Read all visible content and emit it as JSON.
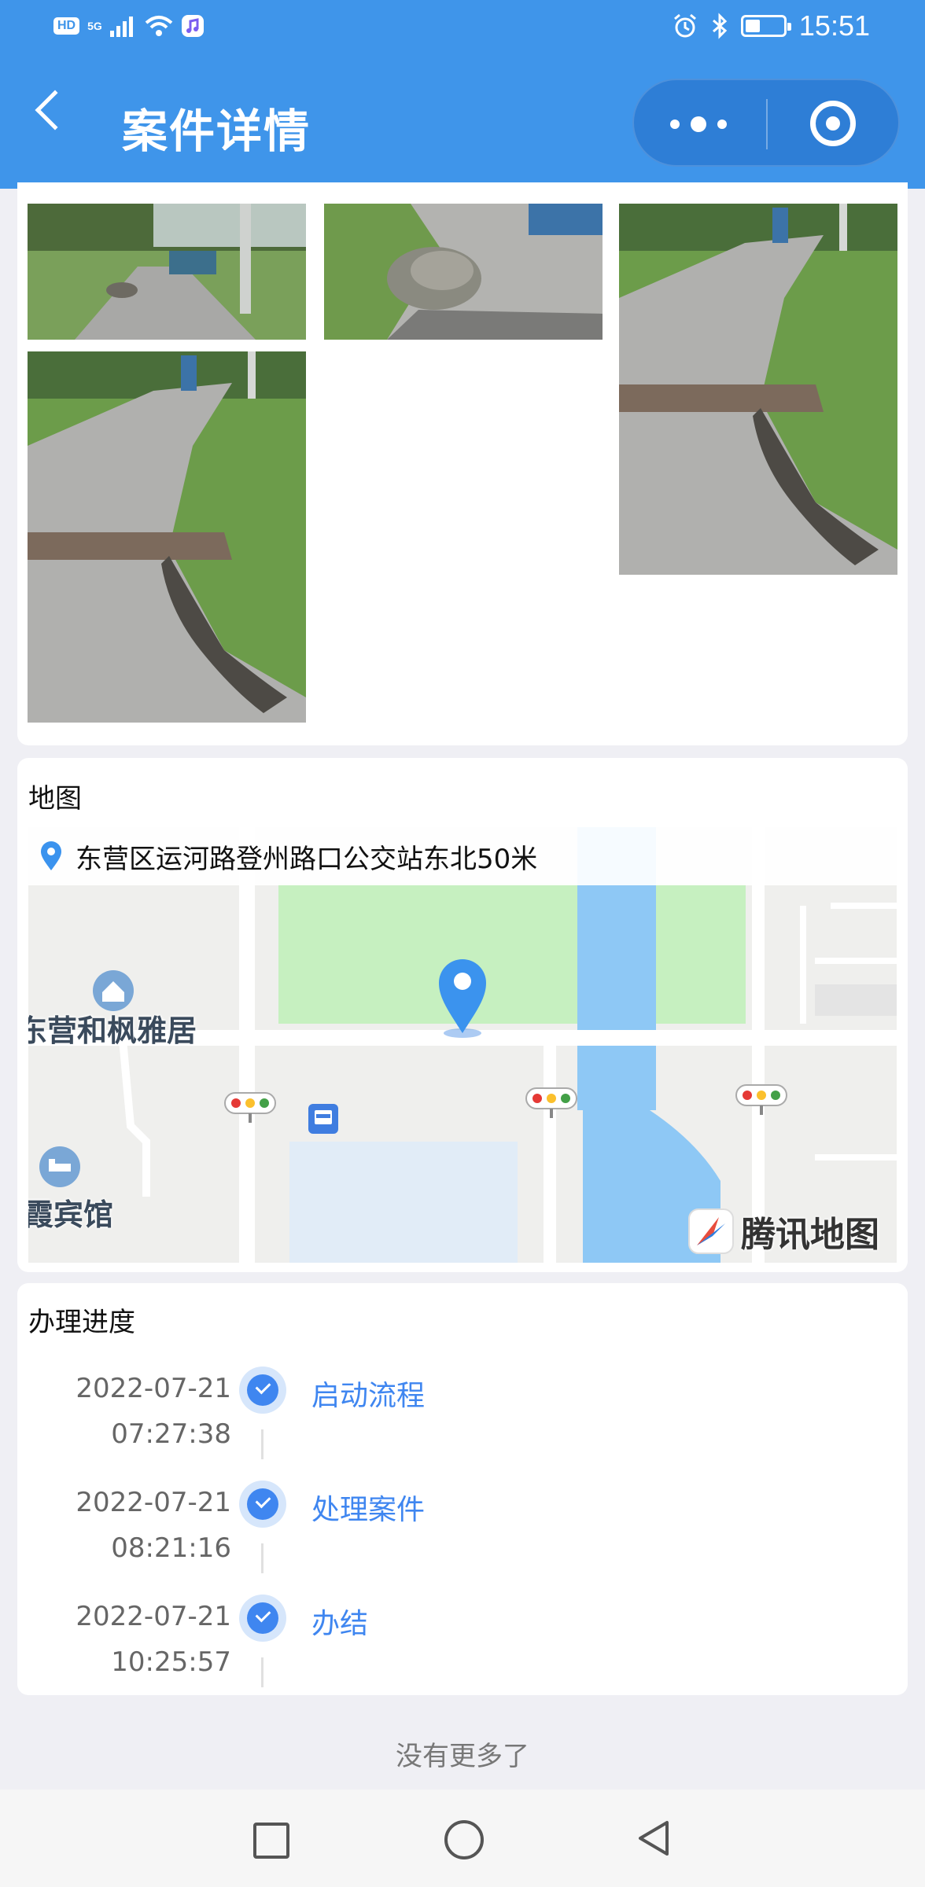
{
  "status_bar": {
    "hd": "HD",
    "network": "5G",
    "time": "15:51"
  },
  "header": {
    "title": "案件详情",
    "back_icon": "chevron-left-icon",
    "more_icon": "more-dots-icon",
    "close_icon": "target-circle-icon",
    "bg_color": "#3f95ea"
  },
  "map_section": {
    "title": "地图",
    "address": "东营区运河路登州路口公交站东北50米",
    "labels": {
      "poi_1": "东营和枫雅居",
      "poi_2": "霞宾馆"
    },
    "provider": "腾讯地图"
  },
  "progress": {
    "title": "办理进度",
    "steps": [
      {
        "date": "2022-07-21",
        "time": "07:27:38",
        "name": "启动流程"
      },
      {
        "date": "2022-07-21",
        "time": "08:21:16",
        "name": "处理案件"
      },
      {
        "date": "2022-07-21",
        "time": "10:25:57",
        "name": "办结"
      }
    ]
  },
  "footer": {
    "no_more": "没有更多了"
  },
  "nav": {
    "recent_icon": "square-icon",
    "home_icon": "circle-icon",
    "back_icon": "triangle-back-icon"
  }
}
